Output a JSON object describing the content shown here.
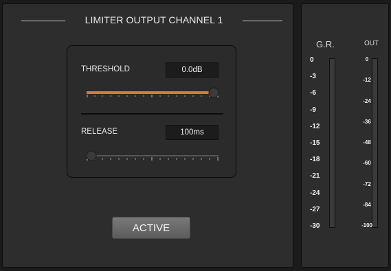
{
  "limiter": {
    "title": "LIMITER OUTPUT CHANNEL 1",
    "threshold": {
      "label": "THRESHOLD",
      "value": "0.0dB",
      "level": 1.0
    },
    "release": {
      "label": "RELEASE",
      "value": "100ms",
      "level": 0.0
    },
    "active_label": "ACTIVE"
  },
  "meters": {
    "gr": {
      "title": "G.R.",
      "scale": [
        "0",
        "-3",
        "-6",
        "-9",
        "-12",
        "-15",
        "-18",
        "-21",
        "-24",
        "-27",
        "-30"
      ]
    },
    "out": {
      "title": "OUT",
      "scale": [
        "0",
        "-12",
        "-24",
        "-36",
        "-48",
        "-60",
        "-72",
        "-84",
        "-100"
      ]
    }
  },
  "colors": {
    "accent_orange": "#e8742a",
    "panel": "#2d2d2d",
    "background": "#1b1b1b"
  }
}
